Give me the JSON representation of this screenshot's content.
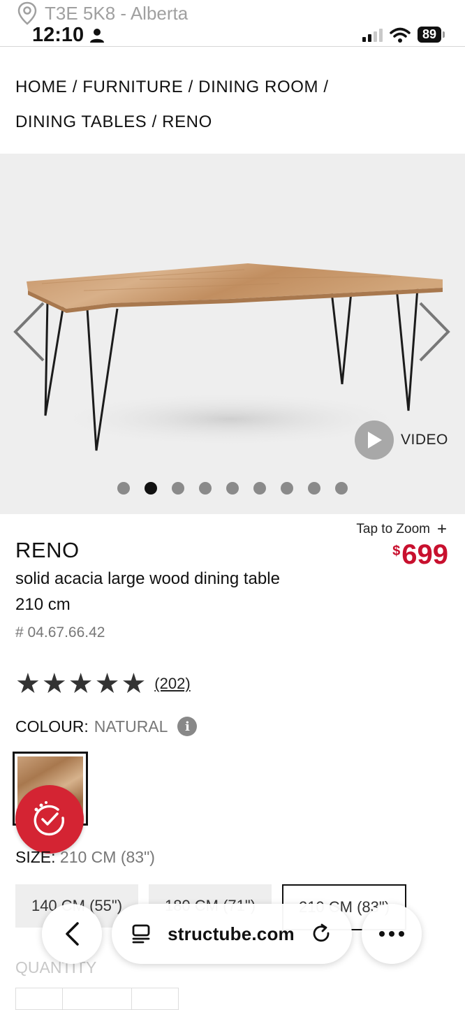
{
  "status_bar": {
    "location": "T3E 5K8 - Alberta",
    "time": "12:10",
    "battery": "89"
  },
  "breadcrumb": {
    "items": [
      "HOME",
      "FURNITURE",
      "DINING ROOM",
      "DINING TABLES",
      "RENO"
    ],
    "separator": "/"
  },
  "gallery": {
    "video_label": "VIDEO",
    "dot_count": 9,
    "active_dot": 1
  },
  "product": {
    "tap_to_zoom": "Tap to Zoom",
    "zoom_plus": "+",
    "currency_symbol": "$",
    "price": "699",
    "name": "RENO",
    "description_line1": "solid acacia large wood dining table",
    "description_line2": "210 cm",
    "sku": "# 04.67.66.42",
    "rating_stars": 5,
    "review_count": "(202)",
    "colour_label": "COLOUR:",
    "colour_value": "NATURAL",
    "size_label": "SIZE:",
    "size_value": "210 CM (83\")",
    "size_options": [
      "140 CM (55\")",
      "180 CM (71\")",
      "210 CM (83\")"
    ],
    "selected_size_index": 2,
    "quantity_label": "QUANTITY"
  },
  "browser": {
    "url": "structube.com"
  },
  "colors": {
    "price_red": "#c8102e",
    "badge_red": "#d42433",
    "gallery_bg": "#eeeeee"
  },
  "icons": [
    "location-pin-icon",
    "person-icon",
    "signal-icon",
    "wifi-icon",
    "battery-icon",
    "chevron-left-icon",
    "chevron-right-icon",
    "play-icon",
    "star-icon",
    "info-icon",
    "promo-check-icon",
    "back-icon",
    "tabs-icon",
    "reload-icon",
    "more-icon"
  ]
}
